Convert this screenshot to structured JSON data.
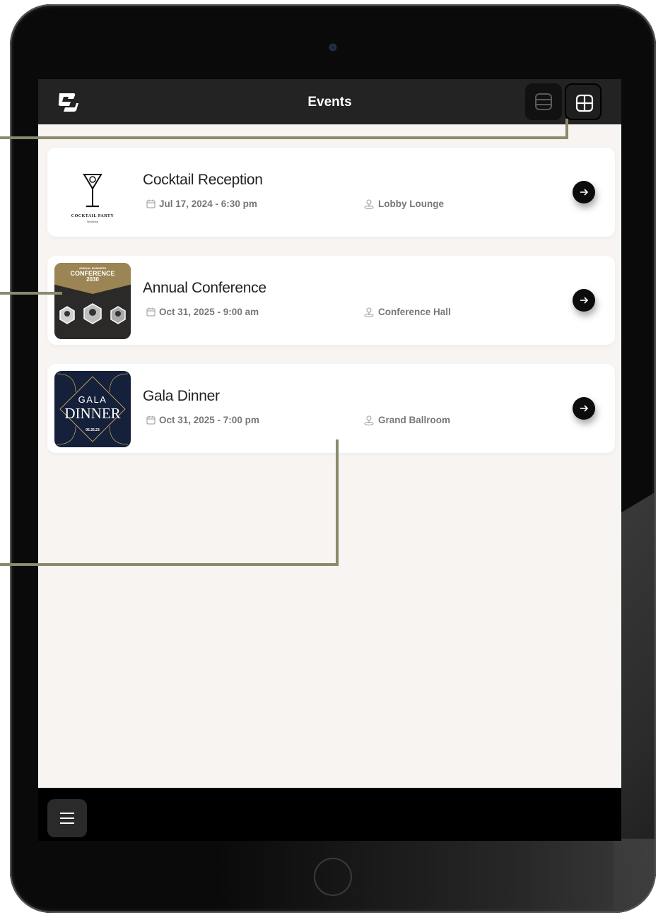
{
  "header": {
    "title": "Events",
    "logo_icon": "app-logo-icon",
    "list_view_icon": "list-view-icon",
    "grid_view_icon": "grid-view-icon"
  },
  "events": [
    {
      "title": "Cocktail Reception",
      "date": "Jul 17, 2024 - 6:30 pm",
      "location": "Lobby Lounge",
      "thumb_text": "COCKTAIL PARTY",
      "thumb_subtext": "Invitation"
    },
    {
      "title": "Annual Conference",
      "date": "Oct 31, 2025 - 9:00 am",
      "location": "Conference Hall",
      "thumb_text": "CONFERENCE",
      "thumb_year": "2030",
      "thumb_kicker": "ANNUAL BUSINESS"
    },
    {
      "title": "Gala Dinner",
      "date": "Oct 31, 2025 - 7:00 pm",
      "location": "Grand Ballroom",
      "thumb_text": "GALA",
      "thumb_text2": "DINNER",
      "thumb_date": "05.25.23"
    }
  ],
  "footer": {
    "menu_icon": "hamburger-menu-icon"
  },
  "colors": {
    "topbar": "#232323",
    "background": "#f7f4f2",
    "callout": "#8a8a6c"
  }
}
